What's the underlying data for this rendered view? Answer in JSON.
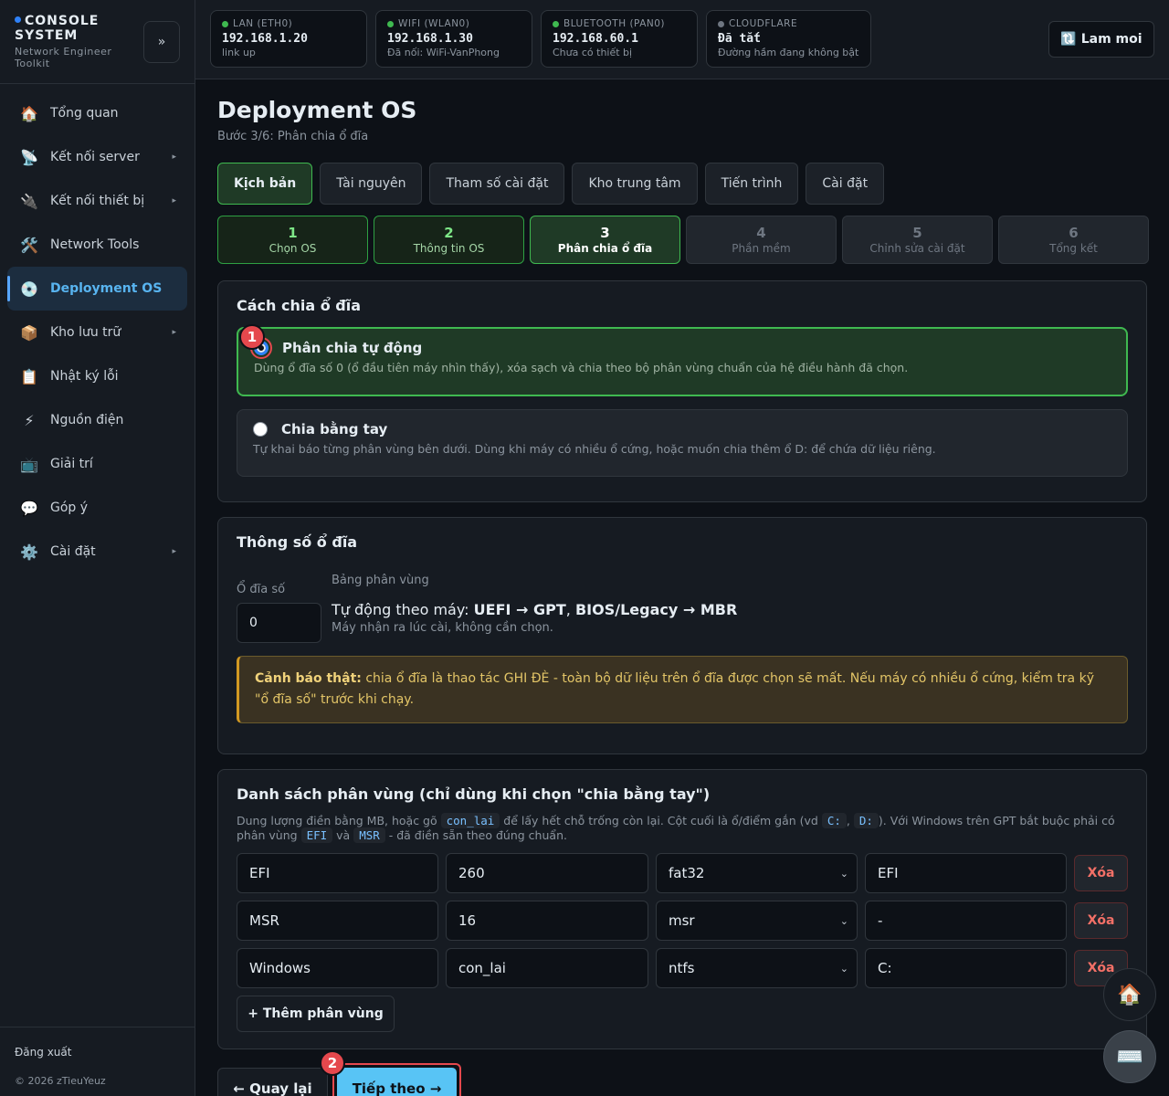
{
  "brand": {
    "title": "CONSOLE SYSTEM",
    "subtitle": "Network Engineer Toolkit",
    "collapse": "»"
  },
  "sidebar": {
    "items": [
      {
        "label": "Tổng quan",
        "icon": "🏠",
        "icon_name": "home-icon"
      },
      {
        "label": "Kết nối server",
        "icon": "📡",
        "icon_name": "satellite-icon",
        "arrow": "▸"
      },
      {
        "label": "Kết nối thiết bị",
        "icon": "🔌",
        "icon_name": "plug-icon",
        "arrow": "▸"
      },
      {
        "label": "Network Tools",
        "icon": "🛠️",
        "icon_name": "tools-icon"
      },
      {
        "label": "Deployment OS",
        "icon": "💿",
        "icon_name": "disc-icon"
      },
      {
        "label": "Kho lưu trữ",
        "icon": "📦",
        "icon_name": "package-icon",
        "arrow": "▸"
      },
      {
        "label": "Nhật ký lỗi",
        "icon": "📋",
        "icon_name": "clipboard-icon"
      },
      {
        "label": "Nguồn điện",
        "icon": "⚡",
        "icon_name": "lightning-icon"
      },
      {
        "label": "Giải trí",
        "icon": "📺",
        "icon_name": "tv-icon"
      },
      {
        "label": "Góp ý",
        "icon": "💬",
        "icon_name": "speech-bubble-icon"
      },
      {
        "label": "Cài đặt",
        "icon": "⚙️",
        "icon_name": "gear-icon",
        "arrow": "▸"
      }
    ],
    "logout": "Đăng xuất",
    "copyright": "© 2026 zTieuYeuz"
  },
  "network": [
    {
      "name": "LAN (ETH0)",
      "ip": "192.168.1.20",
      "status": "link up",
      "color": "#3fb950"
    },
    {
      "name": "WIFI (WLAN0)",
      "ip": "192.168.1.30",
      "status": "Đã nối: WiFi-VanPhong",
      "color": "#3fb950"
    },
    {
      "name": "BLUETOOTH (PAN0)",
      "ip": "192.168.60.1",
      "status": "Chưa có thiết bị",
      "color": "#3fb950"
    },
    {
      "name": "CLOUDFLARE",
      "ip": "Đã tắt",
      "status": "Đường hầm đang không bật",
      "color": "#6e7681"
    }
  ],
  "refresh_label": "🔃 Lam moi",
  "page": {
    "title": "Deployment OS",
    "subtitle": "Bước 3/6: Phân chia ổ đĩa"
  },
  "tabs": [
    "Kịch bản",
    "Tài nguyên",
    "Tham số cài đặt",
    "Kho trung tâm",
    "Tiến trình",
    "Cài đặt"
  ],
  "steps": [
    {
      "num": "1",
      "label": "Chọn OS"
    },
    {
      "num": "2",
      "label": "Thông tin OS"
    },
    {
      "num": "3",
      "label": "Phân chia ổ đĩa"
    },
    {
      "num": "4",
      "label": "Phần mềm"
    },
    {
      "num": "5",
      "label": "Chỉnh sửa cài đặt"
    },
    {
      "num": "6",
      "label": "Tổng kết"
    }
  ],
  "partition_method": {
    "title": "Cách chia ổ đĩa",
    "auto": {
      "label": "Phân chia tự động",
      "desc": "Dùng ổ đĩa số 0 (ổ đầu tiên máy nhìn thấy), xóa sạch và chia theo bộ phân vùng chuẩn của hệ điều hành đã chọn."
    },
    "manual": {
      "label": "Chia bằng tay",
      "desc": "Tự khai báo từng phân vùng bên dưới. Dùng khi máy có nhiều ổ cứng, hoặc muốn chia thêm ổ D: để chứa dữ liệu riêng."
    }
  },
  "disk_params": {
    "title": "Thông số ổ đĩa",
    "disk_label": "Ổ đĩa số",
    "disk_value": "0",
    "table_label": "Bảng phân vùng",
    "table_prefix": "Tự động theo máy:",
    "table_uefi": "UEFI → GPT",
    "table_sep": ",",
    "table_bios": "BIOS/Legacy → MBR",
    "table_note": "Máy nhận ra lúc cài, không cần chọn.",
    "warn_strong": "Cảnh báo thật:",
    "warn_text": "chia ổ đĩa là thao tác GHI ĐÈ - toàn bộ dữ liệu trên ổ đĩa được chọn sẽ mất. Nếu máy có nhiều ổ cứng, kiểm tra kỹ \"ổ đĩa số\" trước khi chạy."
  },
  "partition_list": {
    "title": "Danh sách phân vùng (chỉ dùng khi chọn \"chia bằng tay\")",
    "desc1": "Dung lượng điền bằng MB, hoặc gõ",
    "code_rest": "con_lai",
    "desc2": "để lấy hết chỗ trống còn lại. Cột cuối là ổ/điểm gắn (vd",
    "code_c": "C:",
    "desc3": ",",
    "code_d": "D:",
    "desc4": "). Với Windows trên GPT bắt buộc phải có phân vùng",
    "code_efi": "EFI",
    "desc5": "và",
    "code_msr": "MSR",
    "desc6": "- đã điền sẵn theo đúng chuẩn.",
    "rows": [
      {
        "name": "EFI",
        "size": "260",
        "fs": "fat32",
        "mount": "EFI"
      },
      {
        "name": "MSR",
        "size": "16",
        "fs": "msr",
        "mount": "-"
      },
      {
        "name": "Windows",
        "size": "con_lai",
        "fs": "ntfs",
        "mount": "C:"
      }
    ],
    "delete_label": "Xóa",
    "add_label": "+ Thêm phân vùng"
  },
  "nav_buttons": {
    "back": "← Quay lại",
    "next": "Tiếp theo →"
  },
  "badges": {
    "one": "1",
    "two": "2"
  },
  "fabs": {
    "home": "🏠",
    "keyboard": "⌨️"
  }
}
